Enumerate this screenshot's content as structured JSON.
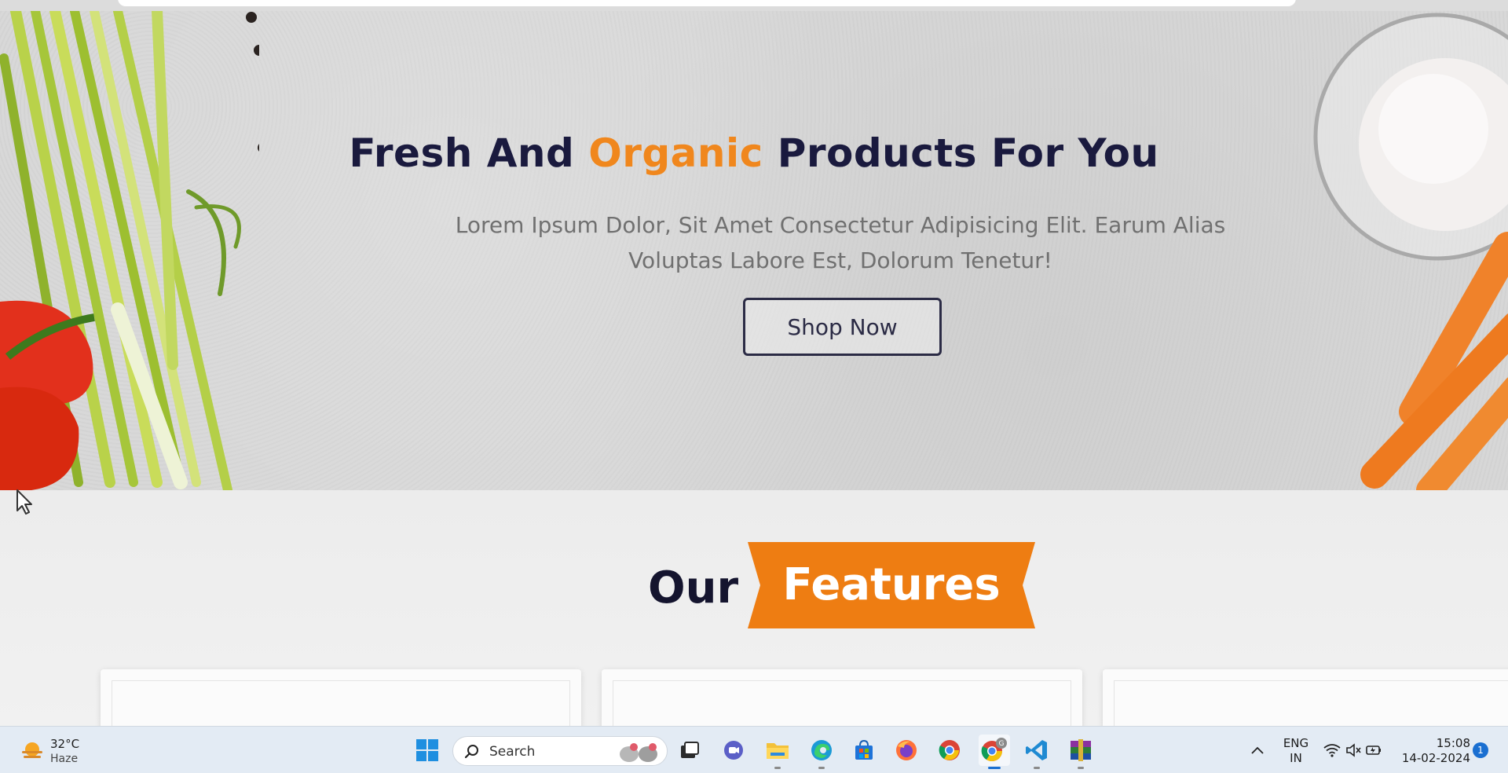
{
  "hero": {
    "title_part1": "Fresh And",
    "title_accent": "Organic",
    "title_part2": "Products For You",
    "subtitle_line1": "Lorem Ipsum Dolor, Sit Amet Consectetur Adipisicing Elit. Earum Alias",
    "subtitle_line2": "Voluptas Labore Est, Dolorum Tenetur!",
    "cta_label": "Shop Now"
  },
  "features": {
    "heading_plain": "Our",
    "heading_highlight": "Features"
  },
  "taskbar": {
    "weather_temp": "32°C",
    "weather_condition": "Haze",
    "search_placeholder": "Search",
    "language_line1": "ENG",
    "language_line2": "IN",
    "time": "15:08",
    "date": "14-02-2024",
    "notification_count": "1",
    "pinned_apps": [
      "start-icon",
      "search-icon",
      "task-view-icon",
      "meet-icon",
      "file-explorer-icon",
      "edge-icon",
      "store-icon",
      "firefox-icon",
      "chrome-icon",
      "chrome-profile-icon",
      "vscode-icon",
      "winrar-icon"
    ]
  },
  "colors": {
    "accent_orange": "#f0871d",
    "heading_navy": "#1a1a3e",
    "taskbar_bg": "#e3ebf4"
  }
}
